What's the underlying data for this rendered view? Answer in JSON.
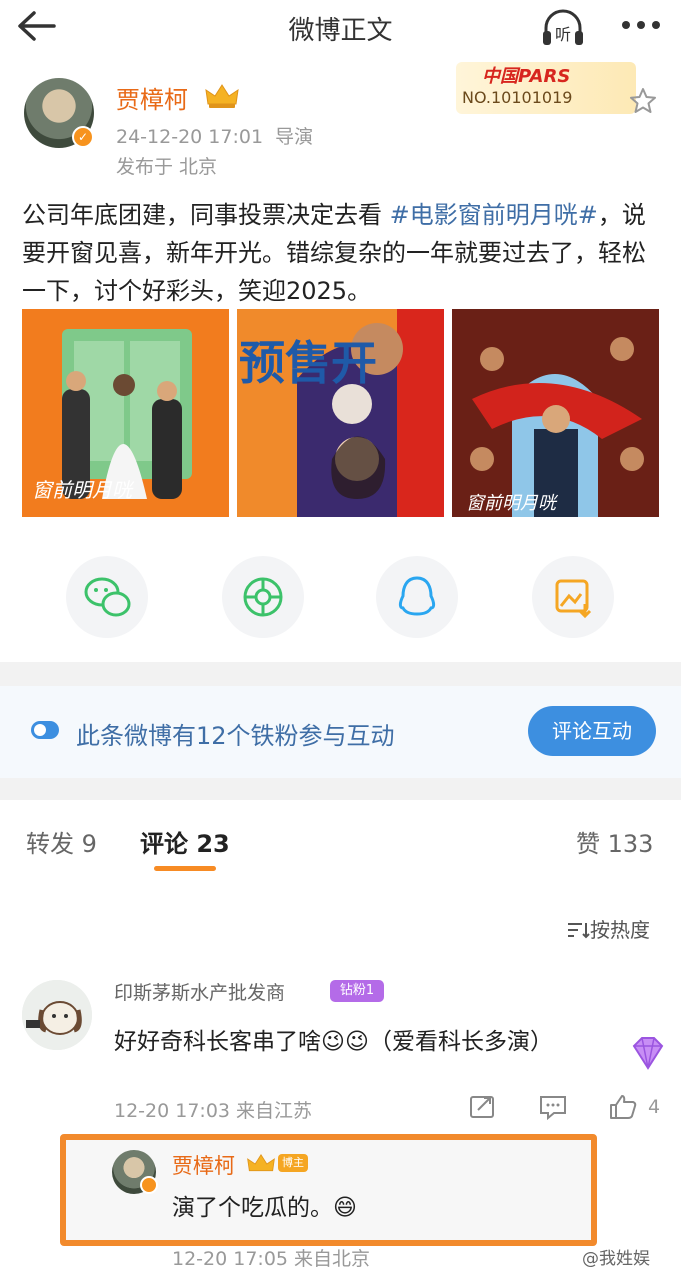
{
  "header": {
    "title": "微博正文",
    "listen_label": "听"
  },
  "post": {
    "author": "贾樟柯",
    "time": "24-12-20 17:01",
    "role": "导演",
    "location": "发布于 北京",
    "stamp_title": "中国PARS",
    "stamp_no": "NO.10101019",
    "text_before": "公司年底团建，同事投票决定去看 ",
    "hashtag": "#电影窗前明月咣#",
    "text_after": "，说要开窗见喜，新年开光。错综复杂的一年就要过去了，轻松一下，讨个好彩头，笑迎2025。",
    "images": [
      {
        "name": "poster-1",
        "caption": "窗前明月咣"
      },
      {
        "name": "poster-2",
        "caption": "预售开"
      },
      {
        "name": "poster-3",
        "caption": "窗前明月咣"
      }
    ]
  },
  "share": [
    "wechat-icon",
    "moments-icon",
    "qq-icon",
    "save-image-icon"
  ],
  "fan_bar": {
    "text": "此条微博有12个铁粉参与互动",
    "button": "评论互动"
  },
  "tabs": {
    "repost": "转发 9",
    "comments": "评论 23",
    "likes": "赞 133"
  },
  "sort_label": "按热度",
  "comment": {
    "name": "印斯茅斯水产批发商",
    "badge": "钻粉1",
    "text": "好好奇科长客串了啥😉😉（爱看科长多演）",
    "time": "12-20 17:03 来自江苏",
    "likes": "4"
  },
  "reply": {
    "name": "贾樟柯",
    "tag": "博主",
    "text": "演了个吃瓜的。😄",
    "time": "12-20 17:05 来自北京"
  },
  "watermark": "@我姓娱",
  "colors": {
    "accent": "#f78b24",
    "link": "#3f6ea6",
    "author": "#e86a17",
    "button": "#3d8fe0"
  }
}
